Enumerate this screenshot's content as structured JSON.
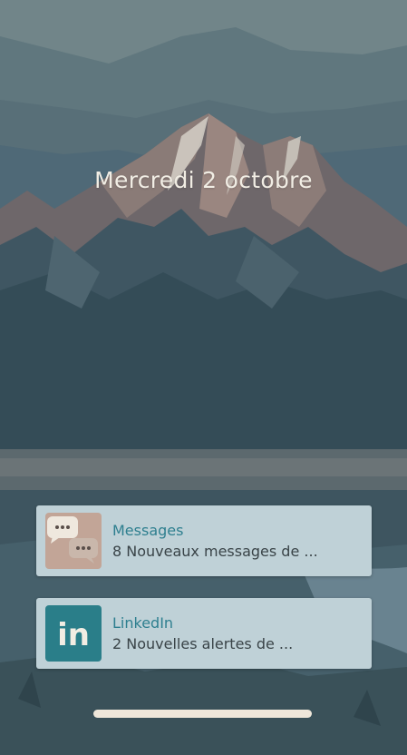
{
  "lockscreen": {
    "date": "Mercredi 2 octobre"
  },
  "notifications": [
    {
      "app": "Messages",
      "icon": "messages-icon",
      "text": "8 Nouveaux messages de ..."
    },
    {
      "app": "LinkedIn",
      "icon": "linkedin-icon",
      "icon_text": "in",
      "text": "2 Nouvelles alertes de ..."
    }
  ],
  "colors": {
    "notification_bg": "#bfd1d7",
    "app_title": "#2e7f8f",
    "linkedin_brand": "#2a7e89",
    "date_text": "#f1ede4"
  }
}
